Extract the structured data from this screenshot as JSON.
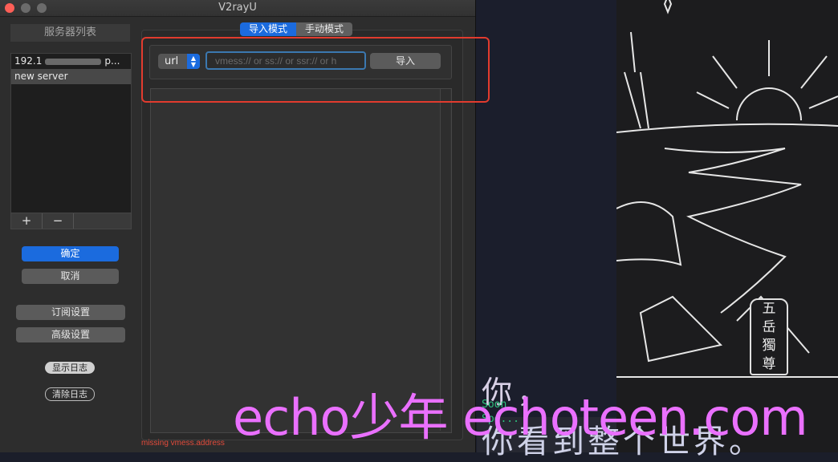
{
  "window": {
    "title": "V2rayU"
  },
  "sidebar": {
    "header": "服务器列表",
    "servers": [
      {
        "name_start": "192.1",
        "name_end": "p..."
      },
      {
        "name": "new server"
      }
    ],
    "add_label": "+",
    "remove_label": "−",
    "ok_label": "确定",
    "cancel_label": "取消",
    "subscription_label": "订阅设置",
    "advanced_label": "高级设置",
    "show_log_label": "显示日志",
    "clear_log_label": "清除日志"
  },
  "tabs": [
    {
      "label": "导入模式",
      "active": true
    },
    {
      "label": "手动模式",
      "active": false
    }
  ],
  "import": {
    "type_value": "url",
    "placeholder": "vmess:// or ss:// or ssr:// or h",
    "import_label": "导入"
  },
  "status": {
    "error": "missing vmess.address"
  },
  "background": {
    "terminal_lines": [
      "Soon",
      "Spe..."
    ],
    "plaque_chars": [
      "五",
      "岳",
      "獨",
      "尊"
    ],
    "cn_line1": "你，",
    "cn_line2": "你看到整个世界。"
  },
  "watermark": "echo少年 echoteen.com",
  "colors": {
    "accent": "#1b6bde",
    "error": "#e24b3b",
    "highlight": "#e23b2e",
    "watermark": "#ea70ff"
  }
}
